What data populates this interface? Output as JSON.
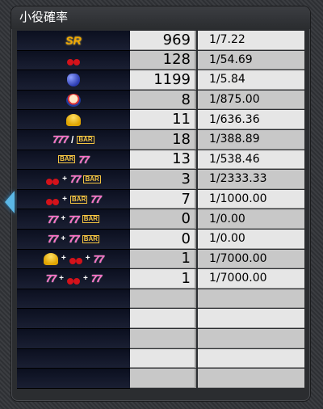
{
  "header": {
    "title": "小役確率"
  },
  "rows": [
    {
      "icon": "sr-icon",
      "count": "969",
      "prob": "1/7.22"
    },
    {
      "icon": "cherry-icon",
      "count": "128",
      "prob": "1/54.69"
    },
    {
      "icon": "grape-icon",
      "count": "1199",
      "prob": "1/5.84"
    },
    {
      "icon": "clown-icon",
      "count": "8",
      "prob": "1/875.00"
    },
    {
      "icon": "bell-icon",
      "count": "11",
      "prob": "1/636.36"
    },
    {
      "icon": "seven-bar-icon",
      "count": "18",
      "prob": "1/388.89"
    },
    {
      "icon": "bar-seven-icon",
      "count": "13",
      "prob": "1/538.46"
    },
    {
      "icon": "cherry-seven-bar-icon",
      "count": "3",
      "prob": "1/2333.33"
    },
    {
      "icon": "cherry-bar-seven-icon",
      "count": "7",
      "prob": "1/1000.00"
    },
    {
      "icon": "seven-seven-bar-icon",
      "count": "0",
      "prob": "1/0.00"
    },
    {
      "icon": "seven-seven-bar-icon",
      "count": "0",
      "prob": "1/0.00"
    },
    {
      "icon": "bell-cherry-seven-icon",
      "count": "1",
      "prob": "1/7000.00"
    },
    {
      "icon": "seven-cherry-seven-icon",
      "count": "1",
      "prob": "1/7000.00"
    }
  ],
  "empty_rows": 5
}
